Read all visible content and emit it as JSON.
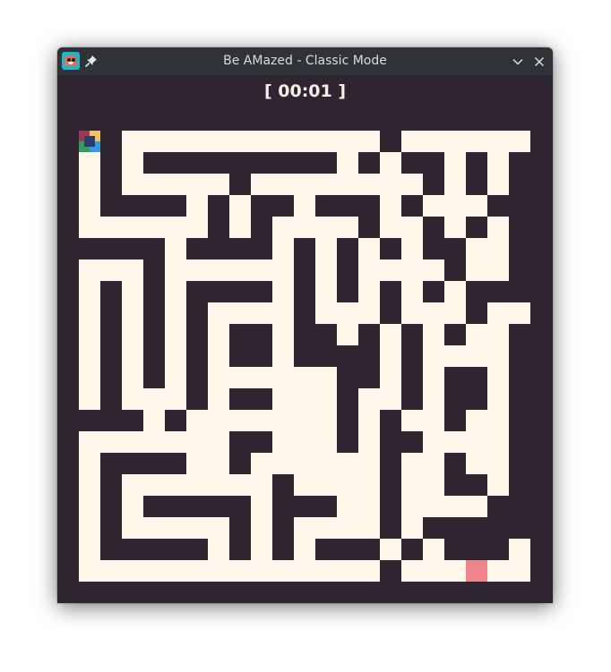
{
  "window": {
    "title": "Be AMazed - Classic Mode",
    "app_icon": "app-face-icon",
    "pin_icon": "pin-icon",
    "minimize_icon": "chevron-down-icon",
    "close_icon": "close-icon"
  },
  "game": {
    "timer": "[ 00:01 ]",
    "colors": {
      "wall": "#2e2531",
      "path": "#fff6ec",
      "goal": "#f0848d",
      "background": "#2e2531"
    },
    "maze": {
      "rows": 21,
      "cols": 21,
      "grid": [
        "PWPPPPPPPPPPPPWPPPPPP",
        "PWPWWWWWWWWWPWPWWPWPW",
        "PWPPPPPWPPPPPPPPWPWPW",
        "PWWWWPWPWWPWWWPWPPPWW",
        "PPPPPPWPWPPPPWPPWPWPW",
        "WWWWPWWWWPWPWPWPWWPPW",
        "PPPWPPPPPPWPWPPPPWPPW",
        "PWPWPWWWWPWPWPWPWPWWW",
        "PWPWPWPPPPWPPPWPPPWPP",
        "PWPWPWPWWPWWPWPWPWPPW",
        "PWPWPWPWWPWWWWPWPPPPW",
        "PWPWPWPPPPPPWWPWPWWPW",
        "PWPPPWPWWPPPWPPWPWWPW",
        "WWWPWPPPPPPPWPWPPWPPW",
        "PPPPPPPWWPPPWPWWPPPPW",
        "PWWWWPPWPPPPPPWPPWPPW",
        "PWPPPPPPPWPPPPWPPWWPW",
        "PWPWWWWWPWWWPPWPPPPWW",
        "PWPPPPPWPWPPPPWPWWWWW",
        "PWWWWWPWPWPWWWPWPWWWP",
        "PPPPPPPPPPPPPPWPPPPPP"
      ],
      "player_cell": {
        "row": 0,
        "col": 0
      },
      "goal_cell": {
        "row": 20,
        "col": 18
      }
    }
  }
}
